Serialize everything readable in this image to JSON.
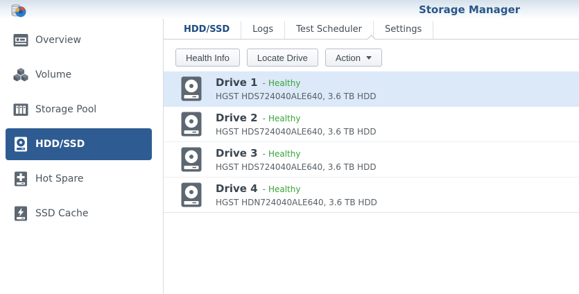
{
  "app": {
    "title": "Storage Manager",
    "logo_icon": "storage-manager-pie-icon"
  },
  "colors": {
    "accent_blue": "#2e5c92",
    "title_blue": "#2a5688",
    "healthy_green": "#3aa33a",
    "selected_row_bg": "#dce9f8",
    "icon_gray": "#5d6771"
  },
  "sidebar": {
    "items": [
      {
        "label": "Overview",
        "icon": "overview-card-icon",
        "active": false
      },
      {
        "label": "Volume",
        "icon": "volume-cubes-icon",
        "active": false
      },
      {
        "label": "Storage Pool",
        "icon": "storage-pool-icon",
        "active": false
      },
      {
        "label": "HDD/SSD",
        "icon": "hdd-drive-icon",
        "active": true
      },
      {
        "label": "Hot Spare",
        "icon": "hot-spare-plus-icon",
        "active": false
      },
      {
        "label": "SSD Cache",
        "icon": "ssd-cache-bolt-icon",
        "active": false
      }
    ]
  },
  "tabs": {
    "items": [
      {
        "label": "HDD/SSD",
        "active": true
      },
      {
        "label": "Logs",
        "active": false
      },
      {
        "label": "Test Scheduler",
        "active": false
      },
      {
        "label": "Settings",
        "active": false
      }
    ]
  },
  "toolbar": {
    "buttons": [
      {
        "label": "Health Info",
        "has_menu": false
      },
      {
        "label": "Locate Drive",
        "has_menu": false
      },
      {
        "label": "Action",
        "has_menu": true
      }
    ]
  },
  "drives": {
    "separator": "-",
    "items": [
      {
        "name": "Drive 1",
        "status": "Healthy",
        "model": "HGST HDS724040ALE640, 3.6 TB HDD",
        "selected": true
      },
      {
        "name": "Drive 2",
        "status": "Healthy",
        "model": "HGST HDS724040ALE640, 3.6 TB HDD",
        "selected": false
      },
      {
        "name": "Drive 3",
        "status": "Healthy",
        "model": "HGST HDS724040ALE640, 3.6 TB HDD",
        "selected": false
      },
      {
        "name": "Drive 4",
        "status": "Healthy",
        "model": "HGST HDN724040ALE640, 3.6 TB HDD",
        "selected": false
      }
    ]
  }
}
